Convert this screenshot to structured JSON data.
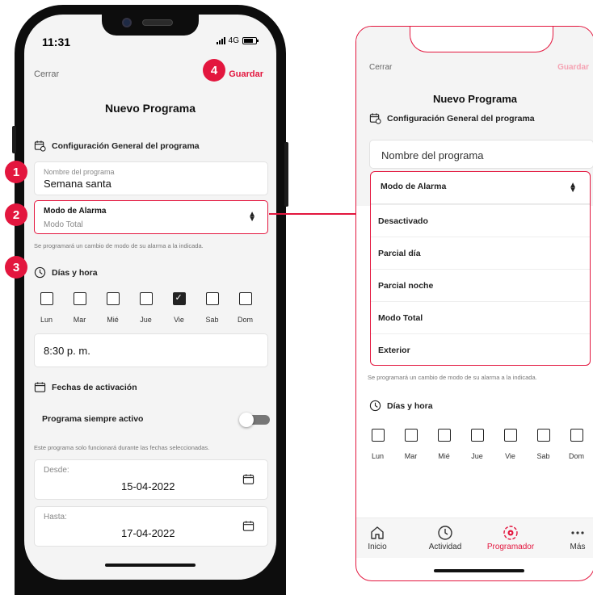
{
  "phone": {
    "status_time": "11:31",
    "network": "4G",
    "close_label": "Cerrar",
    "save_label": "Guardar",
    "title": "Nuevo Programa",
    "general_section": "Configuración General del programa",
    "name_field": {
      "label": "Nombre del programa",
      "value": "Semana santa"
    },
    "mode_field": {
      "label": "Modo de Alarma",
      "value": "Modo Total"
    },
    "mode_hint": "Se programará un cambio de modo de su alarma a la indicada.",
    "days_section": "Días y hora",
    "days": [
      {
        "label": "Lun",
        "checked": false
      },
      {
        "label": "Mar",
        "checked": false
      },
      {
        "label": "Mié",
        "checked": false
      },
      {
        "label": "Jue",
        "checked": false
      },
      {
        "label": "Vie",
        "checked": true
      },
      {
        "label": "Sab",
        "checked": false
      },
      {
        "label": "Dom",
        "checked": false
      }
    ],
    "time_value": "8:30 p. m.",
    "dates_section": "Fechas de activación",
    "always_active_label": "Programa siempre activo",
    "always_active": false,
    "dates_hint": "Este programa solo funcionará durante las fechas seleccionadas.",
    "from_field": {
      "label": "Desde:",
      "value": "15-04-2022"
    },
    "to_field": {
      "label": "Hasta:",
      "value": "17-04-2022"
    }
  },
  "markers": [
    "1",
    "2",
    "3",
    "4"
  ],
  "detail": {
    "close_label": "Cerrar",
    "save_label": "Guardar",
    "title": "Nuevo Programa",
    "general_section": "Configuración General del programa",
    "name_placeholder": "Nombre del programa",
    "dropdown_label": "Modo de Alarma",
    "options": [
      "Desactivado",
      "Parcial día",
      "Parcial noche",
      "Modo Total",
      "Exterior"
    ],
    "mode_hint": "Se programará un cambio de modo de su alarma a la indicada.",
    "days_section": "Días y hora",
    "days": [
      "Lun",
      "Mar",
      "Mié",
      "Jue",
      "Vie",
      "Sab",
      "Dom"
    ],
    "tabs": [
      {
        "label": "Inicio",
        "icon": "home-icon"
      },
      {
        "label": "Actividad",
        "icon": "clock-icon"
      },
      {
        "label": "Programador",
        "icon": "scheduler-icon",
        "active": true
      },
      {
        "label": "Más",
        "icon": "more-icon"
      }
    ]
  },
  "colors": {
    "accent": "#e3163e",
    "background": "#f4f4f4",
    "card": "#ffffff",
    "text": "#1f1f1f",
    "muted": "#888888"
  }
}
